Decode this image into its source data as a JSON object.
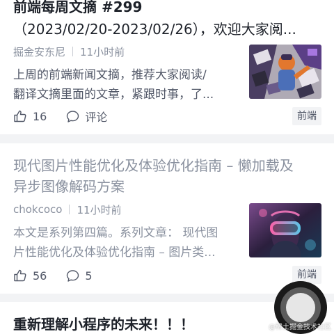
{
  "articles": [
    {
      "title_line1": "前端每周文摘 #299",
      "title_line2": "（2023/02/20-2023/02/26），欢迎大家阅...",
      "author": "掘金安东尼",
      "time": "11小时前",
      "abstract_line1": "上周的前端新闻文摘，推荐大家阅读/",
      "abstract_line2": "翻译文摘里面的文章，紧跟时事，了...",
      "likes": "16",
      "comments_label": "评论",
      "tag": "前端",
      "thumbnail": "illustration-person-with-screens"
    },
    {
      "title_line1": "现代图片性能优化及体验优化指南 – 懒加载及",
      "title_line2": "异步图像解码方案",
      "author": "chokcoco",
      "time": "11小时前",
      "abstract_line1": "本文是系列第四篇。系列文章： 现代图",
      "abstract_line2": "片性能优化及体验优化指南 – 图片类...",
      "likes": "56",
      "comments": "5",
      "tag": "前端",
      "thumbnail": "vr-headset-neon-portrait"
    },
    {
      "title_line1": "重新理解小程序的未来！！！"
    }
  ],
  "floating_button": {
    "icon": "assistive-touch-icon"
  },
  "watermark": "@稀土掘金技术社区",
  "colors": {
    "title": "#1d2129",
    "read_title": "#8a919f",
    "meta": "#8a919f",
    "separator": "#f2f3f5",
    "tag_bg": "#f2f3f5"
  }
}
